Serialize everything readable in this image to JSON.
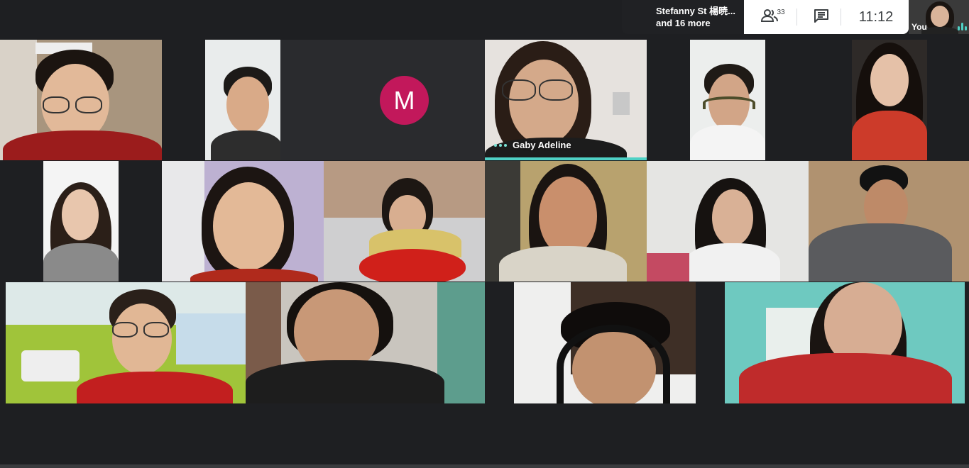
{
  "header": {
    "presenting_line1": "Stefanny St 楊暁...",
    "presenting_line2": "and 16 more",
    "people_count": "33",
    "people_icon": "people-icon",
    "chat_icon": "chat-icon",
    "clock": "11:12",
    "self_label": "You"
  },
  "participants": {
    "avatar_letter": "M",
    "active_speaker_name": "Gaby Adeline"
  },
  "colors": {
    "avatar_bg": "#c2185b",
    "speaking_accent": "#4fd1c5",
    "panel_bg": "#ffffff",
    "page_bg": "#1e1f22"
  }
}
